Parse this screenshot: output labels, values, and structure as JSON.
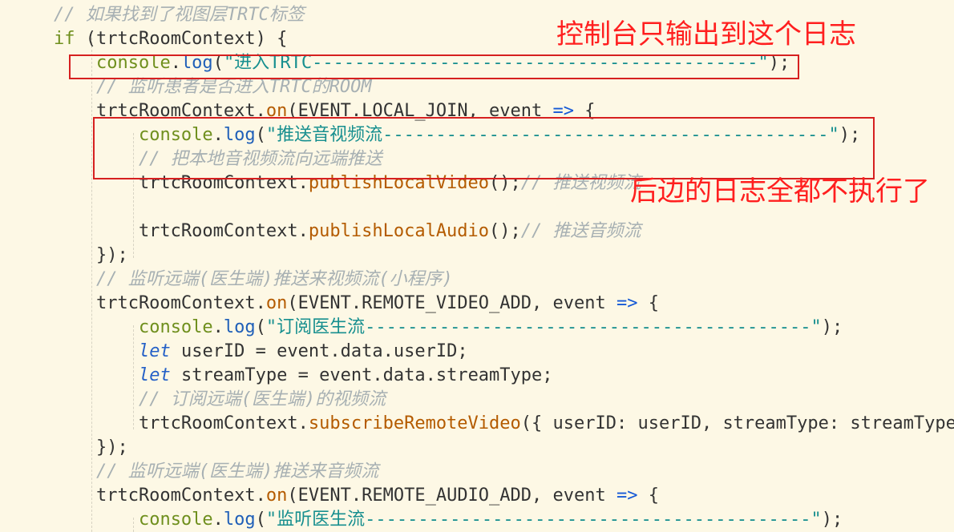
{
  "code_lines": [
    [
      {
        "text": "    ",
        "type": "plain"
      },
      {
        "text": "// 如果找到了视图层TRTC标签",
        "type": "comment"
      }
    ],
    [
      {
        "text": "    ",
        "type": "plain"
      },
      {
        "text": "if",
        "type": "kw"
      },
      {
        "text": " (trtcRoomContext) {",
        "type": "plain"
      }
    ],
    [
      {
        "text": "        ",
        "type": "plain"
      },
      {
        "text": "console",
        "type": "kw"
      },
      {
        "text": ".",
        "type": "plain"
      },
      {
        "text": "log",
        "type": "method"
      },
      {
        "text": "(",
        "type": "plain"
      },
      {
        "text": "\"进入TRTC------------------------------------------\"",
        "type": "str"
      },
      {
        "text": ");",
        "type": "plain"
      }
    ],
    [
      {
        "text": "        ",
        "type": "plain"
      },
      {
        "text": "// 监听患者是否进入TRTC的ROOM",
        "type": "comment"
      }
    ],
    [
      {
        "text": "        trtcRoomContext.",
        "type": "plain"
      },
      {
        "text": "on",
        "type": "fn"
      },
      {
        "text": "(EVENT.LOCAL_JOIN, event ",
        "type": "plain"
      },
      {
        "text": "=>",
        "type": "arrow"
      },
      {
        "text": " {",
        "type": "plain"
      }
    ],
    [
      {
        "text": "            ",
        "type": "plain"
      },
      {
        "text": "console",
        "type": "kw"
      },
      {
        "text": ".",
        "type": "plain"
      },
      {
        "text": "log",
        "type": "method"
      },
      {
        "text": "(",
        "type": "plain"
      },
      {
        "text": "\"推送音视频流------------------------------------------\"",
        "type": "str"
      },
      {
        "text": ");",
        "type": "plain"
      }
    ],
    [
      {
        "text": "            ",
        "type": "plain"
      },
      {
        "text": "// 把本地音视频流向远端推送",
        "type": "comment"
      }
    ],
    [
      {
        "text": "            trtcRoomContext.",
        "type": "plain"
      },
      {
        "text": "publishLocalVideo",
        "type": "fn"
      },
      {
        "text": "();",
        "type": "plain"
      },
      {
        "text": "// 推送视频流",
        "type": "comment"
      }
    ],
    [
      {
        "text": "",
        "type": "plain"
      }
    ],
    [
      {
        "text": "            trtcRoomContext.",
        "type": "plain"
      },
      {
        "text": "publishLocalAudio",
        "type": "fn"
      },
      {
        "text": "();",
        "type": "plain"
      },
      {
        "text": "// 推送音频流",
        "type": "comment"
      }
    ],
    [
      {
        "text": "        });",
        "type": "plain"
      }
    ],
    [
      {
        "text": "        ",
        "type": "plain"
      },
      {
        "text": "// 监听远端(医生端)推送来视频流(小程序)",
        "type": "comment"
      }
    ],
    [
      {
        "text": "        trtcRoomContext.",
        "type": "plain"
      },
      {
        "text": "on",
        "type": "fn"
      },
      {
        "text": "(EVENT.REMOTE_VIDEO_ADD, event ",
        "type": "plain"
      },
      {
        "text": "=>",
        "type": "arrow"
      },
      {
        "text": " {",
        "type": "plain"
      }
    ],
    [
      {
        "text": "            ",
        "type": "plain"
      },
      {
        "text": "console",
        "type": "kw"
      },
      {
        "text": ".",
        "type": "plain"
      },
      {
        "text": "log",
        "type": "method"
      },
      {
        "text": "(",
        "type": "plain"
      },
      {
        "text": "\"订阅医生流------------------------------------------\"",
        "type": "str"
      },
      {
        "text": ");",
        "type": "plain"
      }
    ],
    [
      {
        "text": "            ",
        "type": "plain"
      },
      {
        "text": "let",
        "type": "let"
      },
      {
        "text": " userID = event.data.userID;",
        "type": "plain"
      }
    ],
    [
      {
        "text": "            ",
        "type": "plain"
      },
      {
        "text": "let",
        "type": "let"
      },
      {
        "text": " streamType = event.data.streamType;",
        "type": "plain"
      }
    ],
    [
      {
        "text": "            ",
        "type": "plain"
      },
      {
        "text": "// 订阅远端(医生端)的视频流",
        "type": "comment"
      }
    ],
    [
      {
        "text": "            trtcRoomContext.",
        "type": "plain"
      },
      {
        "text": "subscribeRemoteVideo",
        "type": "fn"
      },
      {
        "text": "({ userID: userID, streamType: streamType }",
        "type": "plain"
      }
    ],
    [
      {
        "text": "        });",
        "type": "plain"
      }
    ],
    [
      {
        "text": "        ",
        "type": "plain"
      },
      {
        "text": "// 监听远端(医生端)推送来音频流",
        "type": "comment"
      }
    ],
    [
      {
        "text": "        trtcRoomContext.",
        "type": "plain"
      },
      {
        "text": "on",
        "type": "fn"
      },
      {
        "text": "(EVENT.REMOTE_AUDIO_ADD, event ",
        "type": "plain"
      },
      {
        "text": "=>",
        "type": "arrow"
      },
      {
        "text": " {",
        "type": "plain"
      }
    ],
    [
      {
        "text": "            ",
        "type": "plain"
      },
      {
        "text": "console",
        "type": "kw"
      },
      {
        "text": ".",
        "type": "plain"
      },
      {
        "text": "log",
        "type": "method"
      },
      {
        "text": "(",
        "type": "plain"
      },
      {
        "text": "\"监听医生流------------------------------------------\"",
        "type": "str"
      },
      {
        "text": ");",
        "type": "plain"
      }
    ]
  ],
  "annotations": {
    "top_note": "控制台只输出到这个日志",
    "side_note": "后边的日志全都不执行了"
  },
  "colors": {
    "background": "#fdf8e5",
    "annotation": "#ff1f1f",
    "box": "#d62020"
  }
}
